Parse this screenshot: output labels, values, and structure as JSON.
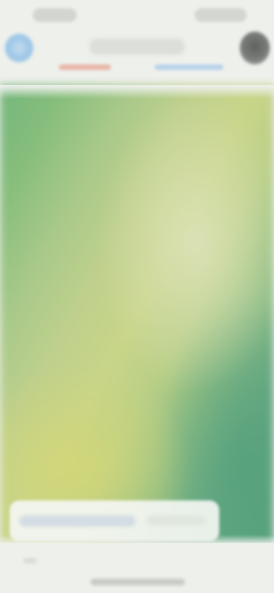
{
  "status_bar": {
    "time": ""
  },
  "nav": {
    "title": "",
    "tabs": [
      {
        "label": "",
        "color": "#e8b6a8"
      },
      {
        "label": "",
        "color": "#b8d2ea"
      }
    ]
  },
  "content": {
    "caption": ""
  },
  "colors": {
    "background": "#eef0ec",
    "gradient_green": "#74b67c",
    "gradient_yellow": "#c8d589",
    "gradient_teal": "#5aa37e"
  },
  "icons": {
    "avatar": "avatar-icon",
    "profile": "profile-icon"
  }
}
